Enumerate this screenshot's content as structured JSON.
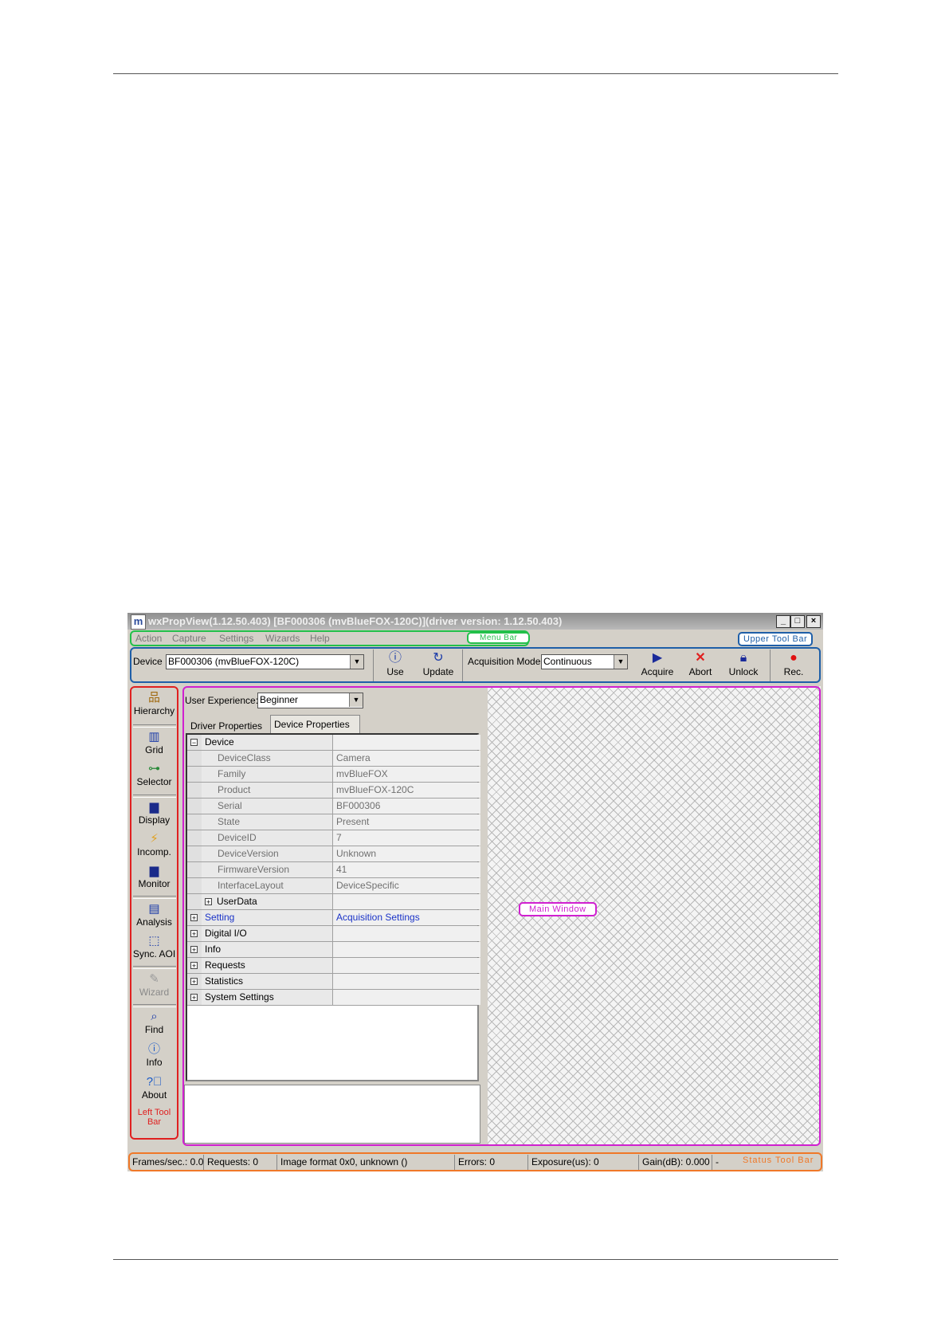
{
  "window": {
    "title": "wxPropView(1.12.50.403) [BF000306 (mvBlueFOX-120C)](driver version: 1.12.50.403)",
    "icon_letter": "m",
    "controls": {
      "minimize": "_",
      "maximize": "□",
      "close": "×"
    }
  },
  "menu": [
    "Action",
    "Capture",
    "Settings",
    "Wizards",
    "Help"
  ],
  "callouts": {
    "menu_bar": "Menu Bar",
    "upper_tool_bar": "Upper Tool Bar",
    "left_tool_bar_line1": "Left Tool",
    "left_tool_bar_line2": "Bar",
    "main_window": "Main Window",
    "status_tool_bar": "Status Tool Bar"
  },
  "toolbar": {
    "device_label": "Device",
    "device_value": "BF000306 (mvBlueFOX-120C)",
    "use": "Use",
    "update": "Update",
    "acq_mode_label": "Acquisition Mode",
    "acq_mode_value": "Continuous",
    "acquire": "Acquire",
    "abort": "Abort",
    "unlock": "Unlock",
    "rec": "Rec."
  },
  "left_toolbar": [
    "Hierarchy",
    "Grid",
    "Selector",
    "Display",
    "Incomp.",
    "Monitor",
    "Analysis",
    "Sync. AOI",
    "Wizard",
    "Find",
    "Info",
    "About"
  ],
  "props": {
    "user_experience_label": "User Experience:",
    "user_experience_value": "Beginner",
    "tab_driver": "Driver Properties",
    "tab_device": "Device Properties",
    "rows": [
      {
        "name": "Device",
        "value": "",
        "level": 0,
        "sign": "−"
      },
      {
        "name": "DeviceClass",
        "value": "Camera",
        "level": 1,
        "sign": ""
      },
      {
        "name": "Family",
        "value": "mvBlueFOX",
        "level": 1,
        "sign": ""
      },
      {
        "name": "Product",
        "value": "mvBlueFOX-120C",
        "level": 1,
        "sign": ""
      },
      {
        "name": "Serial",
        "value": "BF000306",
        "level": 1,
        "sign": ""
      },
      {
        "name": "State",
        "value": "Present",
        "level": 1,
        "sign": ""
      },
      {
        "name": "DeviceID",
        "value": "7",
        "level": 1,
        "sign": ""
      },
      {
        "name": "DeviceVersion",
        "value": "Unknown",
        "level": 1,
        "sign": ""
      },
      {
        "name": "FirmwareVersion",
        "value": "41",
        "level": 1,
        "sign": ""
      },
      {
        "name": "InterfaceLayout",
        "value": "DeviceSpecific",
        "level": 1,
        "sign": ""
      },
      {
        "name": "UserData",
        "value": "",
        "level": 2,
        "sign": "+"
      },
      {
        "name": "Setting",
        "value": "Acquisition Settings",
        "level": 0,
        "sign": "+",
        "blue": true
      },
      {
        "name": "Digital I/O",
        "value": "",
        "level": 0,
        "sign": "+"
      },
      {
        "name": "Info",
        "value": "",
        "level": 0,
        "sign": "+"
      },
      {
        "name": "Requests",
        "value": "",
        "level": 0,
        "sign": "+"
      },
      {
        "name": "Statistics",
        "value": "",
        "level": 0,
        "sign": "+"
      },
      {
        "name": "System Settings",
        "value": "",
        "level": 0,
        "sign": "+"
      }
    ]
  },
  "status": {
    "fps": "Frames/sec.: 0.0",
    "requests": "Requests: 0",
    "image_format": "Image format 0x0, unknown ()",
    "errors": "Errors: 0",
    "exposure": "Exposure(us): 0",
    "gain": "Gain(dB): 0.000",
    "dash": "-"
  },
  "colors": {
    "menu_bar": "#22c04a",
    "upper_tool_bar": "#1f5fa8",
    "left_tool_bar": "#e02020",
    "main_window": "#d020d0",
    "status_tool_bar": "#f07828"
  }
}
